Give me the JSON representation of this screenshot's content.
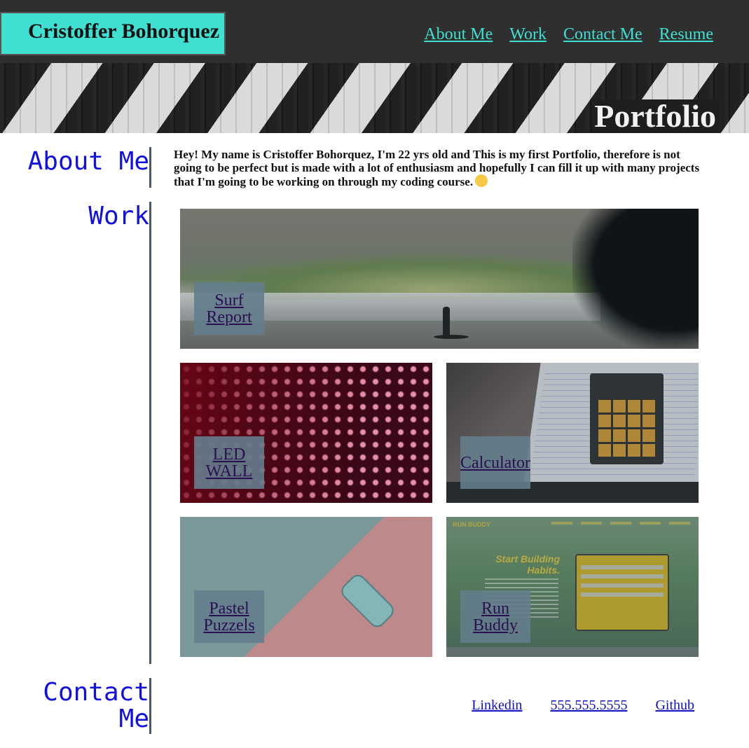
{
  "header": {
    "name": "Cristoffer Bohorquez",
    "nav": [
      "About Me",
      "Work",
      "Contact Me",
      "Resume"
    ]
  },
  "hero": {
    "title": "Portfolio"
  },
  "about": {
    "heading": "About Me",
    "text": "Hey! My name is Cristoffer Bohorquez, I'm 22 yrs old and This is my first Portfolio, therefore is not going to be perfect but is made with a lot of enthusiasm and hopefully I can fill it up with many projects that I'm going to be working on through my coding course."
  },
  "work": {
    "heading": "Work",
    "projects": [
      {
        "label": "Surf Report"
      },
      {
        "label": "LED WALL"
      },
      {
        "label": "Calculator"
      },
      {
        "label": "Pastel Puzzels"
      },
      {
        "label": "Run Buddy"
      }
    ],
    "runbuddy_preview": {
      "brand": "RUN BUDDY",
      "headline": "Start Building Habits."
    }
  },
  "contact": {
    "heading": "Contact Me",
    "links": [
      "Linkedin",
      "555.555.5555",
      "Github"
    ]
  },
  "colors": {
    "header_bg": "#2f2f2f",
    "accent": "#3fdfd2",
    "heading_blue": "#1010e0",
    "divider": "#4a5670"
  },
  "icons": {
    "emoji": "smiling-face-icon"
  }
}
